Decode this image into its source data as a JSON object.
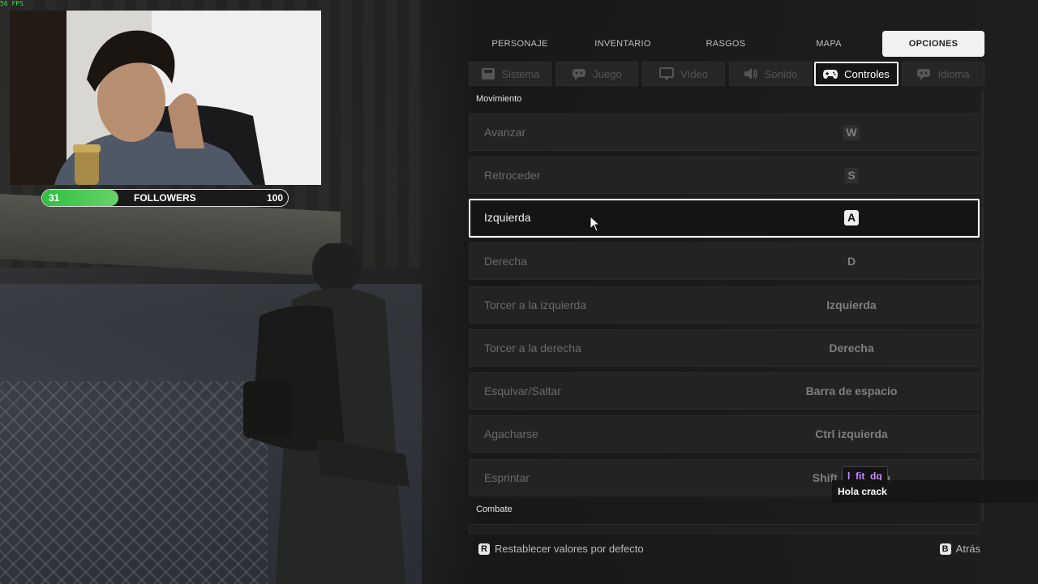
{
  "overlay": {
    "fps": "56 FPS",
    "followers": {
      "current": "31",
      "label": "FOLLOWERS",
      "goal": "100",
      "progress": 0.31
    },
    "chat": {
      "username": "l_fit_dq",
      "message": "Hola crack"
    }
  },
  "top_tabs": [
    {
      "label": "PERSONAJE"
    },
    {
      "label": "INVENTARIO"
    },
    {
      "label": "RASGOS"
    },
    {
      "label": "MAPA"
    },
    {
      "label": "OPCIONES",
      "active": true
    }
  ],
  "sub_tabs": [
    {
      "label": "Sistema",
      "icon": "monitor-save-icon"
    },
    {
      "label": "Juego",
      "icon": "gamepad-chat-icon"
    },
    {
      "label": "Vídeo",
      "icon": "display-icon"
    },
    {
      "label": "Sonido",
      "icon": "speaker-icon"
    },
    {
      "label": "Controles",
      "icon": "controller-icon",
      "active": true
    },
    {
      "label": "Idioma",
      "icon": "speech-icon"
    }
  ],
  "sections": {
    "movement": "Movimiento",
    "combat": "Combate"
  },
  "bindings": [
    {
      "action": "Avanzar",
      "key": "W"
    },
    {
      "action": "Retroceder",
      "key": "S"
    },
    {
      "action": "Izquierda",
      "key": "A",
      "selected": true
    },
    {
      "action": "Derecha",
      "key": "D"
    },
    {
      "action": "Torcer a la izquierda",
      "key": "Izquierda"
    },
    {
      "action": "Torcer a la derecha",
      "key": "Derecha"
    },
    {
      "action": "Esquivar/Saltar",
      "key": "Barra de espacio"
    },
    {
      "action": "Agacharse",
      "key": "Ctrl izquierda"
    },
    {
      "action": "Esprintar",
      "key": "Shift izquierda"
    }
  ],
  "footer": {
    "reset_key": "R",
    "reset_label": "Restablecer valores por defecto",
    "back_key": "B",
    "back_label": "Atrás"
  },
  "colors": {
    "accent": "#f2f2f2",
    "follower_bar": "#3cc84a",
    "chat_username": "#c48bff"
  }
}
